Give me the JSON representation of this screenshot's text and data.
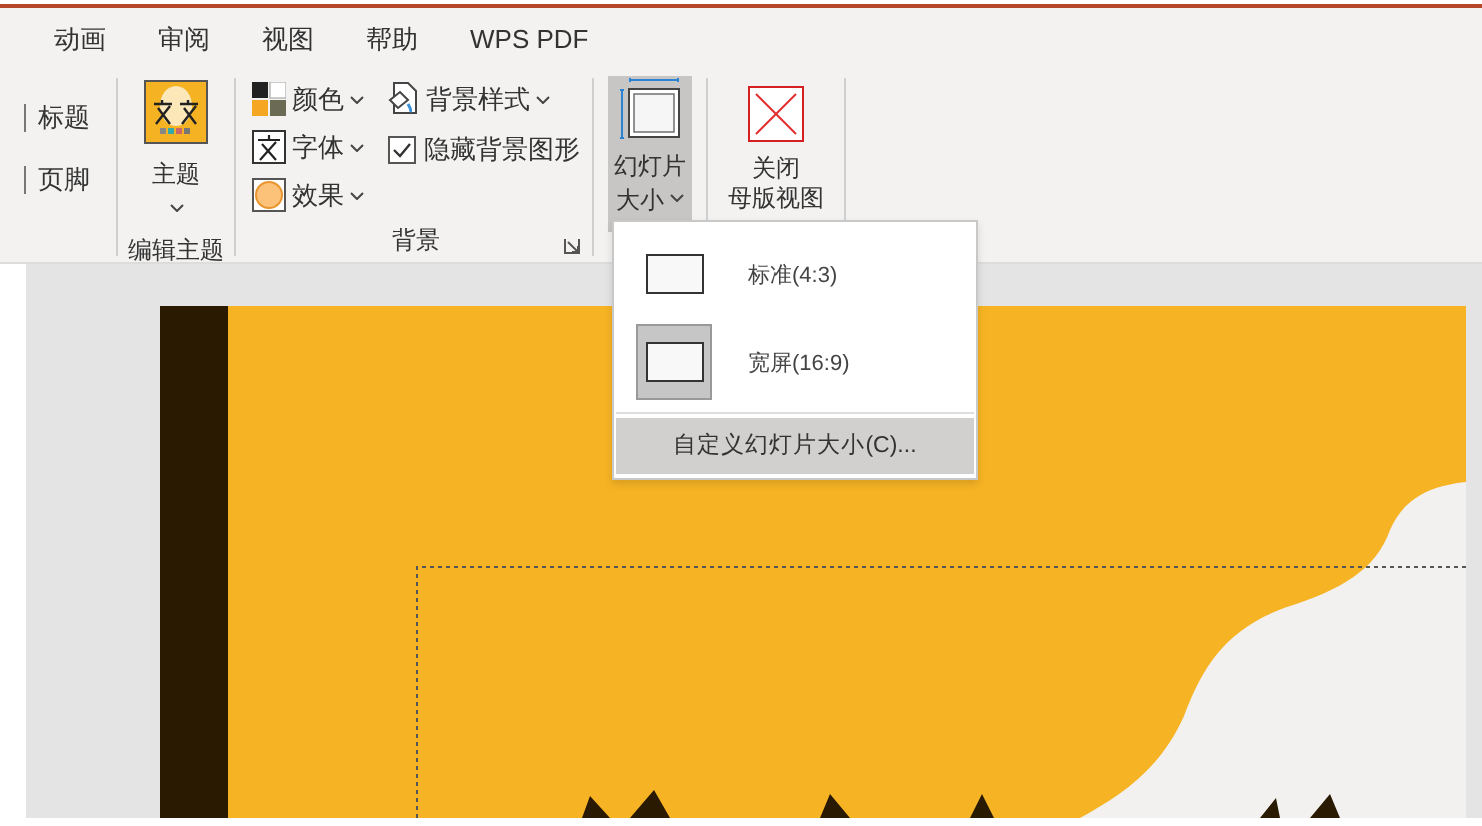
{
  "menu_tabs": [
    {
      "label": "动画",
      "selected": false
    },
    {
      "label": "审阅",
      "selected": false
    },
    {
      "label": "视图",
      "selected": false
    },
    {
      "label": "帮助",
      "selected": false
    },
    {
      "label": "WPS PDF",
      "selected": false
    }
  ],
  "ribbon": {
    "partial_group": {
      "items": [
        "标题",
        "页脚"
      ]
    },
    "edit_theme": {
      "theme_button": {
        "label": "主题"
      },
      "group_label": "编辑主题"
    },
    "background": {
      "dropdowns": [
        {
          "label": "颜色",
          "kind": "colors"
        },
        {
          "label": "字体",
          "kind": "fonts"
        },
        {
          "label": "效果",
          "kind": "effects"
        },
        {
          "label": "背景样式",
          "kind": "style"
        }
      ],
      "hide_graphics": {
        "label": "隐藏背景图形",
        "checked": true
      },
      "group_label": "背景"
    },
    "slide_size": {
      "label_lines": [
        "幻灯片",
        "大小"
      ],
      "expanded": true
    },
    "close_master": {
      "label_lines": [
        "关闭",
        "母版视图"
      ]
    }
  },
  "size_menu": {
    "options": [
      {
        "label": "标准(4:3)",
        "selected": false
      },
      {
        "label": "宽屏(16:9)",
        "selected": true
      }
    ],
    "custom": {
      "label": "自定义幻灯片大小(C)...",
      "hovered": true
    }
  }
}
